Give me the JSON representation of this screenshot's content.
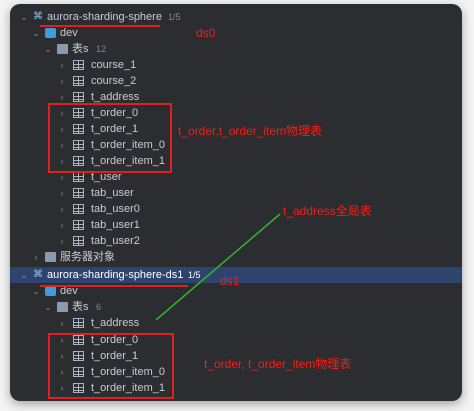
{
  "tree": {
    "ds0": {
      "name": "aurora-sharding-sphere",
      "count": "1/5"
    },
    "ds0_dev": "dev",
    "ds0_tables": {
      "label": "表s",
      "count": "12"
    },
    "ds0_items": [
      "course_1",
      "course_2",
      "t_address",
      "t_order_0",
      "t_order_1",
      "t_order_item_0",
      "t_order_item_1",
      "t_user",
      "tab_user",
      "tab_user0",
      "tab_user1",
      "tab_user2"
    ],
    "ds0_objects": "服务器对象",
    "ds1": {
      "name": "aurora-sharding-sphere-ds1",
      "count": "1/5"
    },
    "ds1_dev": "dev",
    "ds1_tables": {
      "label": "表s",
      "count": "6"
    },
    "ds1_items": [
      "t_address",
      "t_order_0",
      "t_order_1",
      "t_order_item_0",
      "t_order_item_1"
    ]
  },
  "annotations": {
    "ds0": "ds0",
    "physical_top": "t_order,t_order_item物理表",
    "global": "t_address全局表",
    "ds1": "ds1",
    "physical_bottom": "t_order, t_order_item物理表"
  },
  "colors": {
    "panel": "#2b2d30",
    "selection": "#2e436e",
    "annotation": "#e0201c",
    "arrow": "#2fb52f"
  }
}
